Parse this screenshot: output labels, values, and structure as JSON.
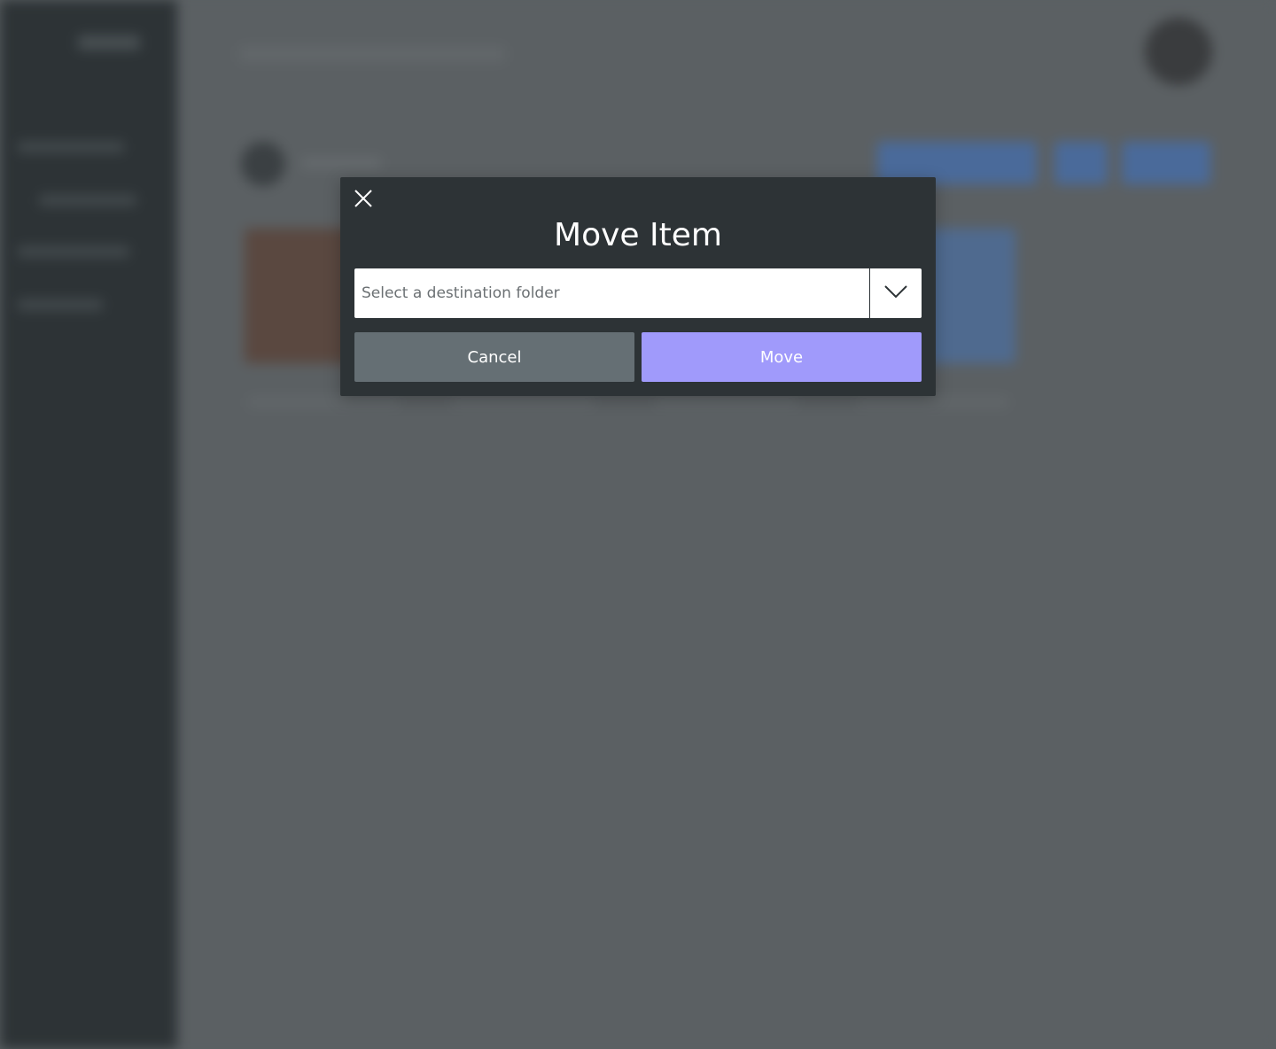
{
  "modal": {
    "title": "Move Item",
    "select": {
      "placeholder": "Select a destination folder"
    },
    "cancel_label": "Cancel",
    "move_label": "Move"
  },
  "icons": {
    "close": "close-icon",
    "dropdown": "chevron-down-icon"
  },
  "colors": {
    "overlay_background": "#5b6063",
    "modal_background": "#2d3336",
    "cancel_button": "#656f74",
    "move_button": "#a09afb"
  }
}
